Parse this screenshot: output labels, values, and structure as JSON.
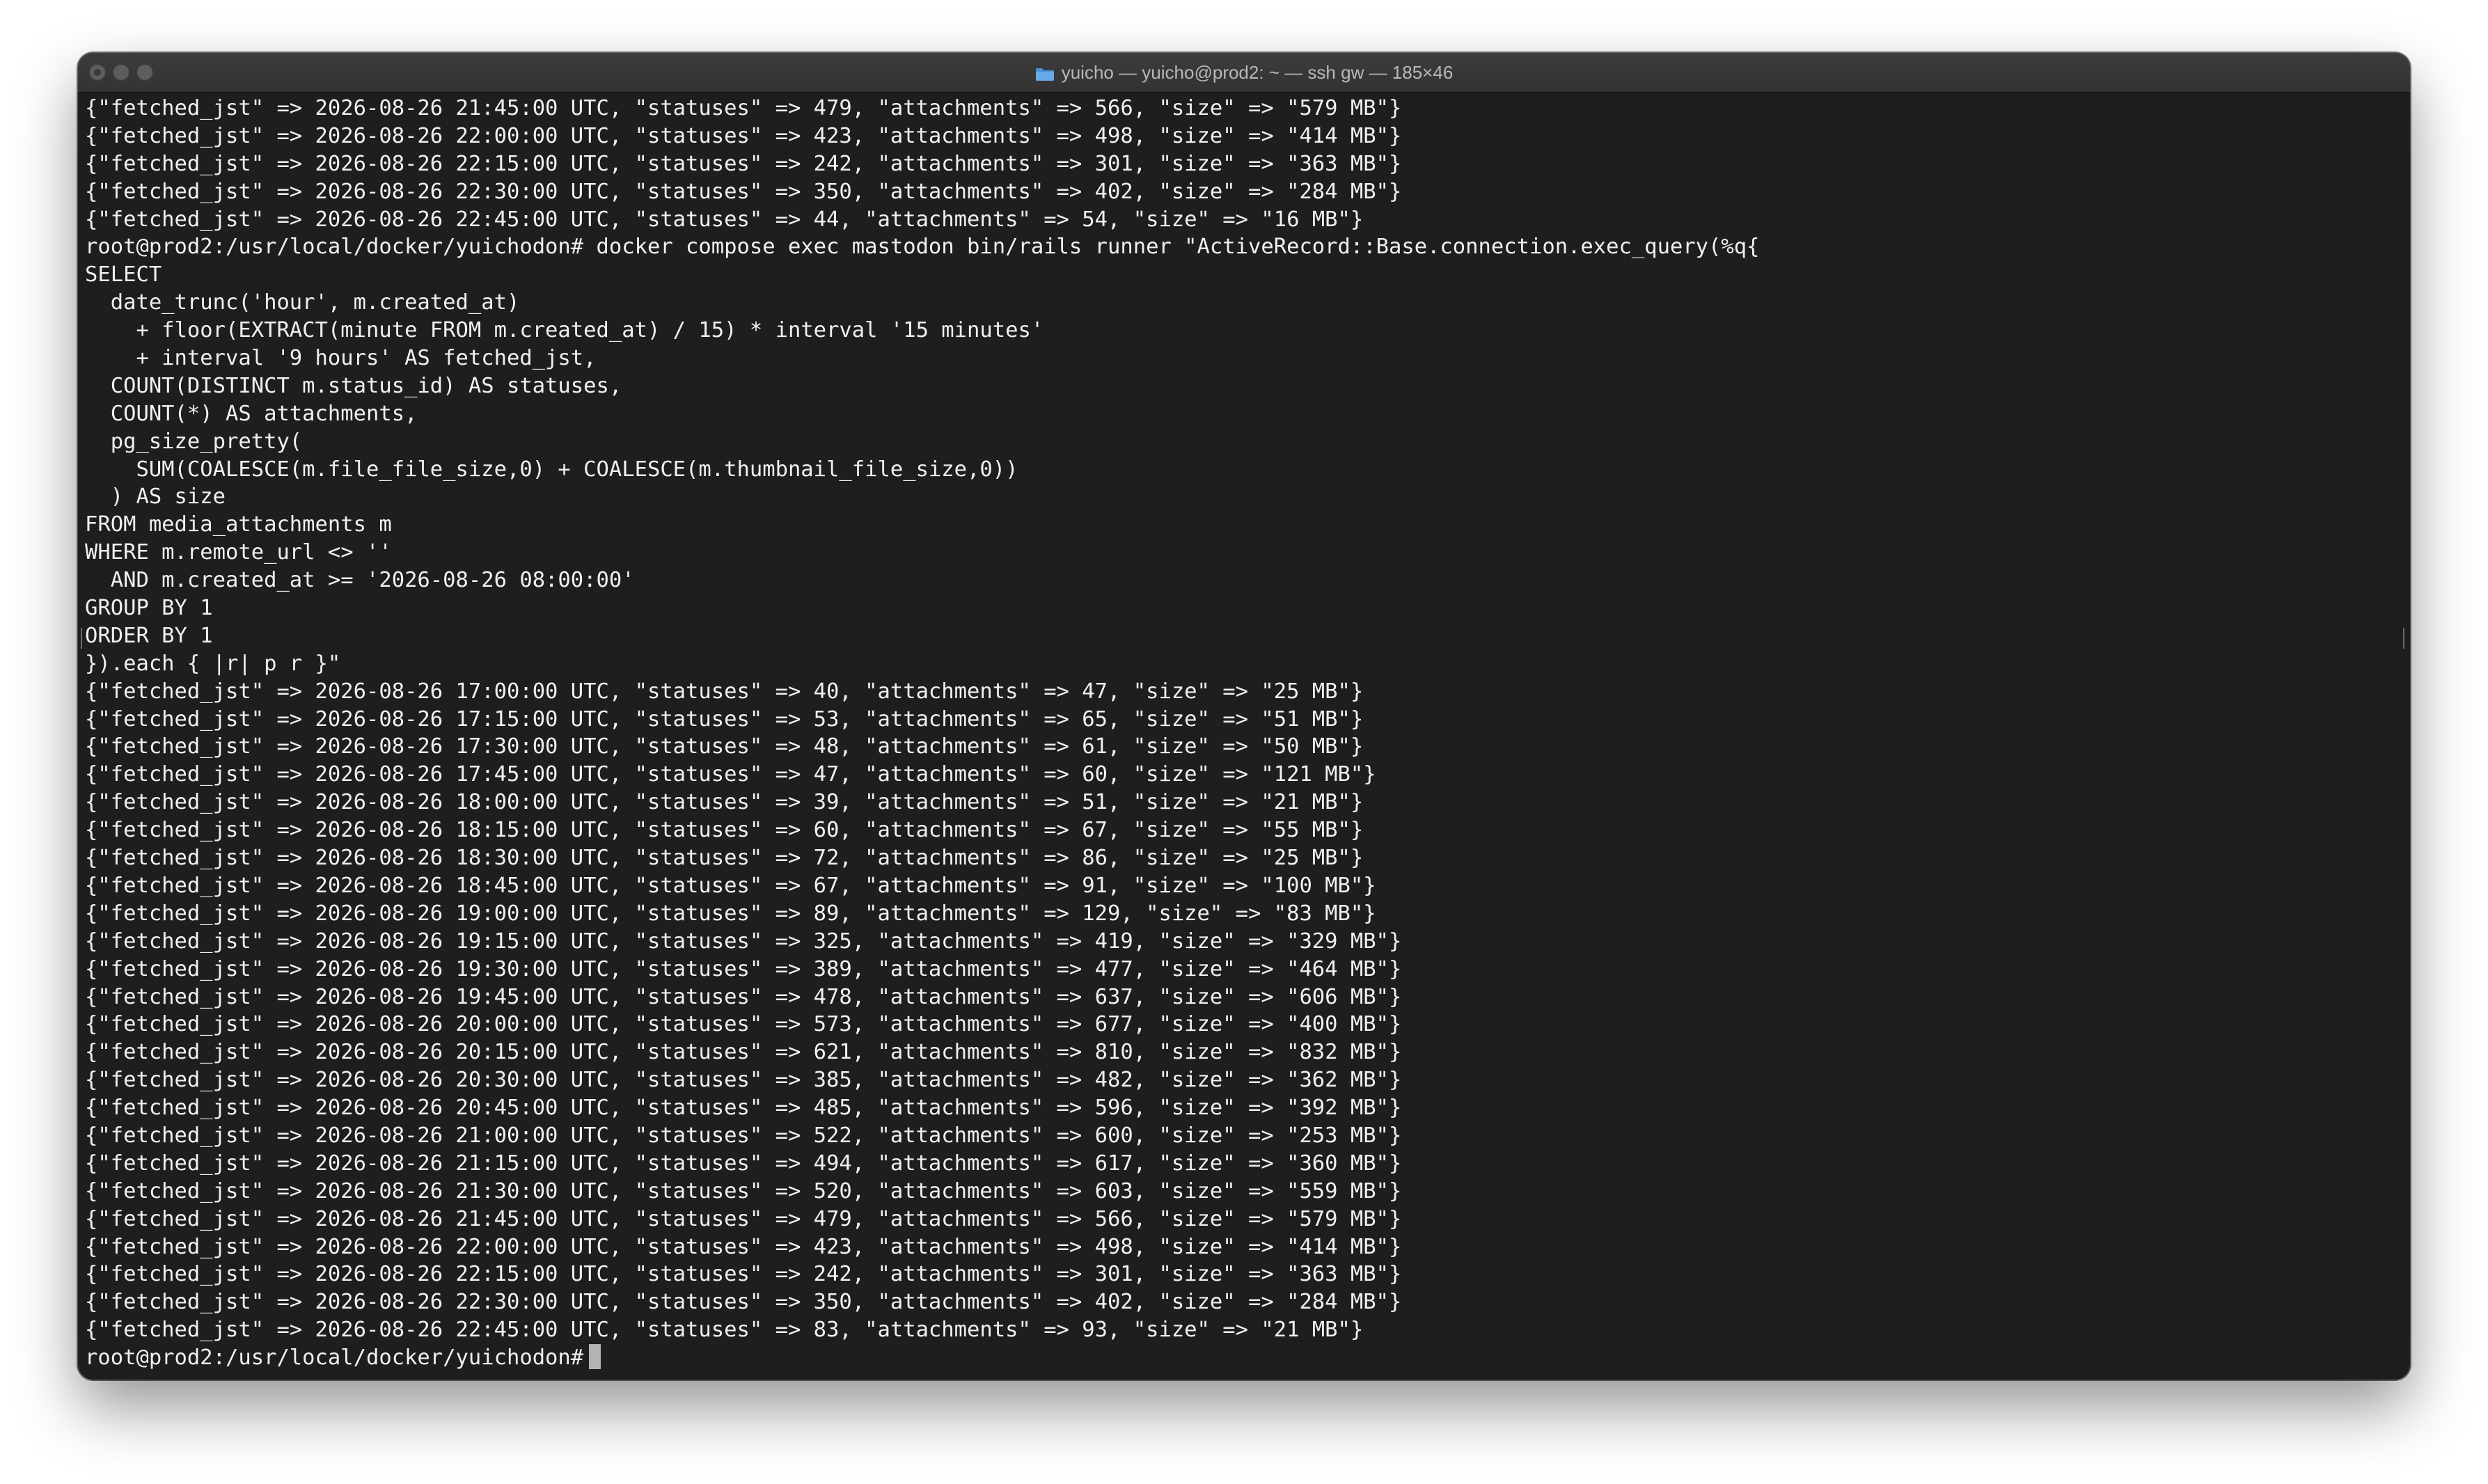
{
  "window": {
    "title": "yuicho — yuicho@prod2: ~ — ssh gw — 185×46",
    "accent_color": "#4a90d9",
    "icon": "folder-icon"
  },
  "terminal": {
    "lines": [
      "{\"fetched_jst\" => 2026-08-26 21:45:00 UTC, \"statuses\" => 479, \"attachments\" => 566, \"size\" => \"579 MB\"}",
      "{\"fetched_jst\" => 2026-08-26 22:00:00 UTC, \"statuses\" => 423, \"attachments\" => 498, \"size\" => \"414 MB\"}",
      "{\"fetched_jst\" => 2026-08-26 22:15:00 UTC, \"statuses\" => 242, \"attachments\" => 301, \"size\" => \"363 MB\"}",
      "{\"fetched_jst\" => 2026-08-26 22:30:00 UTC, \"statuses\" => 350, \"attachments\" => 402, \"size\" => \"284 MB\"}",
      "{\"fetched_jst\" => 2026-08-26 22:45:00 UTC, \"statuses\" => 44, \"attachments\" => 54, \"size\" => \"16 MB\"}",
      "root@prod2:/usr/local/docker/yuichodon# docker compose exec mastodon bin/rails runner \"ActiveRecord::Base.connection.exec_query(%q{",
      "SELECT",
      "  date_trunc('hour', m.created_at)",
      "    + floor(EXTRACT(minute FROM m.created_at) / 15) * interval '15 minutes'",
      "    + interval '9 hours' AS fetched_jst,",
      "  COUNT(DISTINCT m.status_id) AS statuses,",
      "  COUNT(*) AS attachments,",
      "  pg_size_pretty(",
      "    SUM(COALESCE(m.file_file_size,0) + COALESCE(m.thumbnail_file_size,0))",
      "  ) AS size",
      "FROM media_attachments m",
      "WHERE m.remote_url <> ''",
      "  AND m.created_at >= '2026-08-26 08:00:00'",
      "GROUP BY 1",
      "ORDER BY 1",
      "}).each { |r| p r }\"",
      "{\"fetched_jst\" => 2026-08-26 17:00:00 UTC, \"statuses\" => 40, \"attachments\" => 47, \"size\" => \"25 MB\"}",
      "{\"fetched_jst\" => 2026-08-26 17:15:00 UTC, \"statuses\" => 53, \"attachments\" => 65, \"size\" => \"51 MB\"}",
      "{\"fetched_jst\" => 2026-08-26 17:30:00 UTC, \"statuses\" => 48, \"attachments\" => 61, \"size\" => \"50 MB\"}",
      "{\"fetched_jst\" => 2026-08-26 17:45:00 UTC, \"statuses\" => 47, \"attachments\" => 60, \"size\" => \"121 MB\"}",
      "{\"fetched_jst\" => 2026-08-26 18:00:00 UTC, \"statuses\" => 39, \"attachments\" => 51, \"size\" => \"21 MB\"}",
      "{\"fetched_jst\" => 2026-08-26 18:15:00 UTC, \"statuses\" => 60, \"attachments\" => 67, \"size\" => \"55 MB\"}",
      "{\"fetched_jst\" => 2026-08-26 18:30:00 UTC, \"statuses\" => 72, \"attachments\" => 86, \"size\" => \"25 MB\"}",
      "{\"fetched_jst\" => 2026-08-26 18:45:00 UTC, \"statuses\" => 67, \"attachments\" => 91, \"size\" => \"100 MB\"}",
      "{\"fetched_jst\" => 2026-08-26 19:00:00 UTC, \"statuses\" => 89, \"attachments\" => 129, \"size\" => \"83 MB\"}",
      "{\"fetched_jst\" => 2026-08-26 19:15:00 UTC, \"statuses\" => 325, \"attachments\" => 419, \"size\" => \"329 MB\"}",
      "{\"fetched_jst\" => 2026-08-26 19:30:00 UTC, \"statuses\" => 389, \"attachments\" => 477, \"size\" => \"464 MB\"}",
      "{\"fetched_jst\" => 2026-08-26 19:45:00 UTC, \"statuses\" => 478, \"attachments\" => 637, \"size\" => \"606 MB\"}",
      "{\"fetched_jst\" => 2026-08-26 20:00:00 UTC, \"statuses\" => 573, \"attachments\" => 677, \"size\" => \"400 MB\"}",
      "{\"fetched_jst\" => 2026-08-26 20:15:00 UTC, \"statuses\" => 621, \"attachments\" => 810, \"size\" => \"832 MB\"}",
      "{\"fetched_jst\" => 2026-08-26 20:30:00 UTC, \"statuses\" => 385, \"attachments\" => 482, \"size\" => \"362 MB\"}",
      "{\"fetched_jst\" => 2026-08-26 20:45:00 UTC, \"statuses\" => 485, \"attachments\" => 596, \"size\" => \"392 MB\"}",
      "{\"fetched_jst\" => 2026-08-26 21:00:00 UTC, \"statuses\" => 522, \"attachments\" => 600, \"size\" => \"253 MB\"}",
      "{\"fetched_jst\" => 2026-08-26 21:15:00 UTC, \"statuses\" => 494, \"attachments\" => 617, \"size\" => \"360 MB\"}",
      "{\"fetched_jst\" => 2026-08-26 21:30:00 UTC, \"statuses\" => 520, \"attachments\" => 603, \"size\" => \"559 MB\"}",
      "{\"fetched_jst\" => 2026-08-26 21:45:00 UTC, \"statuses\" => 479, \"attachments\" => 566, \"size\" => \"579 MB\"}",
      "{\"fetched_jst\" => 2026-08-26 22:00:00 UTC, \"statuses\" => 423, \"attachments\" => 498, \"size\" => \"414 MB\"}",
      "{\"fetched_jst\" => 2026-08-26 22:15:00 UTC, \"statuses\" => 242, \"attachments\" => 301, \"size\" => \"363 MB\"}",
      "{\"fetched_jst\" => 2026-08-26 22:30:00 UTC, \"statuses\" => 350, \"attachments\" => 402, \"size\" => \"284 MB\"}",
      "{\"fetched_jst\" => 2026-08-26 22:45:00 UTC, \"statuses\" => 83, \"attachments\" => 93, \"size\" => \"21 MB\"}"
    ],
    "prompt": "root@prod2:/usr/local/docker/yuichodon# ",
    "colors": {
      "background": "#1e1e1e",
      "foreground": "#f0f0f0",
      "cursor": "#b3b3b3"
    }
  }
}
